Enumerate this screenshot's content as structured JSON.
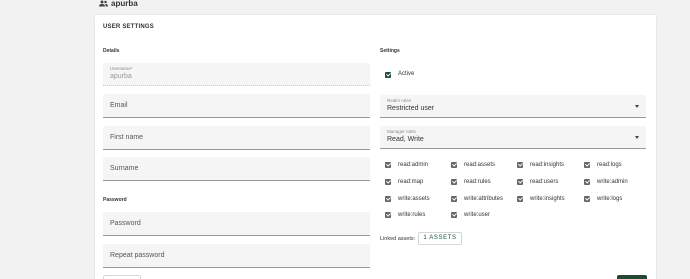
{
  "header": {
    "username": "apurba",
    "user_icon": "users-icon"
  },
  "card": {
    "title": "USER SETTINGS"
  },
  "details": {
    "label": "Details",
    "username_label": "Username*",
    "username_value": "apurba",
    "email_placeholder": "Email",
    "first_name_placeholder": "First name",
    "surname_placeholder": "Surname"
  },
  "password": {
    "label": "Password",
    "password_placeholder": "Password",
    "repeat_placeholder": "Repeat password"
  },
  "settings": {
    "label": "Settings",
    "active_label": "Active",
    "active_checked": true,
    "realm_roles_label": "Realm roles",
    "realm_roles_value": "Restricted user",
    "manager_roles_label": "Manager roles",
    "manager_roles_value": "Read, Write",
    "permissions": [
      {
        "label": "read:admin",
        "checked": true
      },
      {
        "label": "read:assets",
        "checked": true
      },
      {
        "label": "read:insights",
        "checked": true
      },
      {
        "label": "read:logs",
        "checked": true
      },
      {
        "label": "read:map",
        "checked": true
      },
      {
        "label": "read:rules",
        "checked": true
      },
      {
        "label": "read:users",
        "checked": true
      },
      {
        "label": "write:admin",
        "checked": true
      },
      {
        "label": "write:assets",
        "checked": true
      },
      {
        "label": "write:attributes",
        "checked": true
      },
      {
        "label": "write:insights",
        "checked": true
      },
      {
        "label": "write:logs",
        "checked": true
      },
      {
        "label": "write:rules",
        "checked": true
      },
      {
        "label": "write:user",
        "checked": true
      }
    ],
    "linked_assets_label": "Linked assets:",
    "linked_assets_button": "1 ASSETS"
  },
  "colors": {
    "accent": "#1b4d32",
    "checkbox_disabled": "#666666"
  }
}
